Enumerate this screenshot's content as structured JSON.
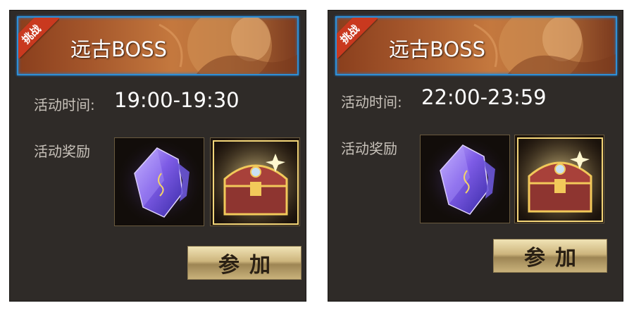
{
  "panels": [
    {
      "badge": "挑战",
      "title": "远古BOSS",
      "time_label": "活动时间:",
      "time_value": "19:00-19:30",
      "reward_label": "活动奖励",
      "rewards": [
        "purple-crystal-icon",
        "golden-treasure-chest-icon"
      ],
      "join_label": "参加"
    },
    {
      "badge": "挑战",
      "title": "远古BOSS",
      "time_label": "活动时间:",
      "time_value": "22:00-23:59",
      "reward_label": "活动奖励",
      "rewards": [
        "purple-crystal-icon",
        "golden-treasure-chest-icon"
      ],
      "join_label": "参加"
    }
  ],
  "colors": {
    "banner_border": "#2f8fd6",
    "ribbon": "#c9391f",
    "panel_bg": "#2f2b28",
    "button_gold": "#cdb57d"
  }
}
